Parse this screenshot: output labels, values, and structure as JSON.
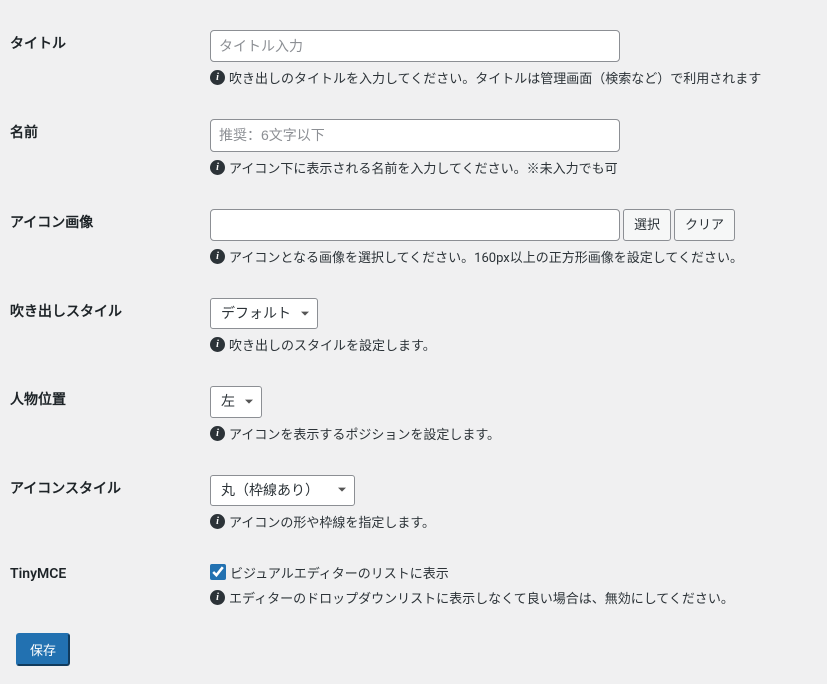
{
  "fields": {
    "title": {
      "label": "タイトル",
      "placeholder": "タイトル入力",
      "value": "",
      "description": "吹き出しのタイトルを入力してください。タイトルは管理画面（検索など）で利用されます"
    },
    "name": {
      "label": "名前",
      "placeholder": "推奨：6文字以下",
      "value": "",
      "description": "アイコン下に表示される名前を入力してください。※未入力でも可"
    },
    "icon_image": {
      "label": "アイコン画像",
      "value": "",
      "select_btn": "選択",
      "clear_btn": "クリア",
      "description": "アイコンとなる画像を選択してください。160px以上の正方形画像を設定してください。"
    },
    "balloon_style": {
      "label": "吹き出しスタイル",
      "selected": "デフォルト",
      "description": "吹き出しのスタイルを設定します。"
    },
    "position": {
      "label": "人物位置",
      "selected": "左",
      "description": "アイコンを表示するポジションを設定します。"
    },
    "icon_style": {
      "label": "アイコンスタイル",
      "selected": "丸（枠線あり）",
      "description": "アイコンの形や枠線を指定します。"
    },
    "tinymce": {
      "label": "TinyMCE",
      "checkbox_label": "ビジュアルエディターのリストに表示",
      "checked": true,
      "description": "エディターのドロップダウンリストに表示しなくて良い場合は、無効にしてください。"
    }
  },
  "submit_label": "保存"
}
